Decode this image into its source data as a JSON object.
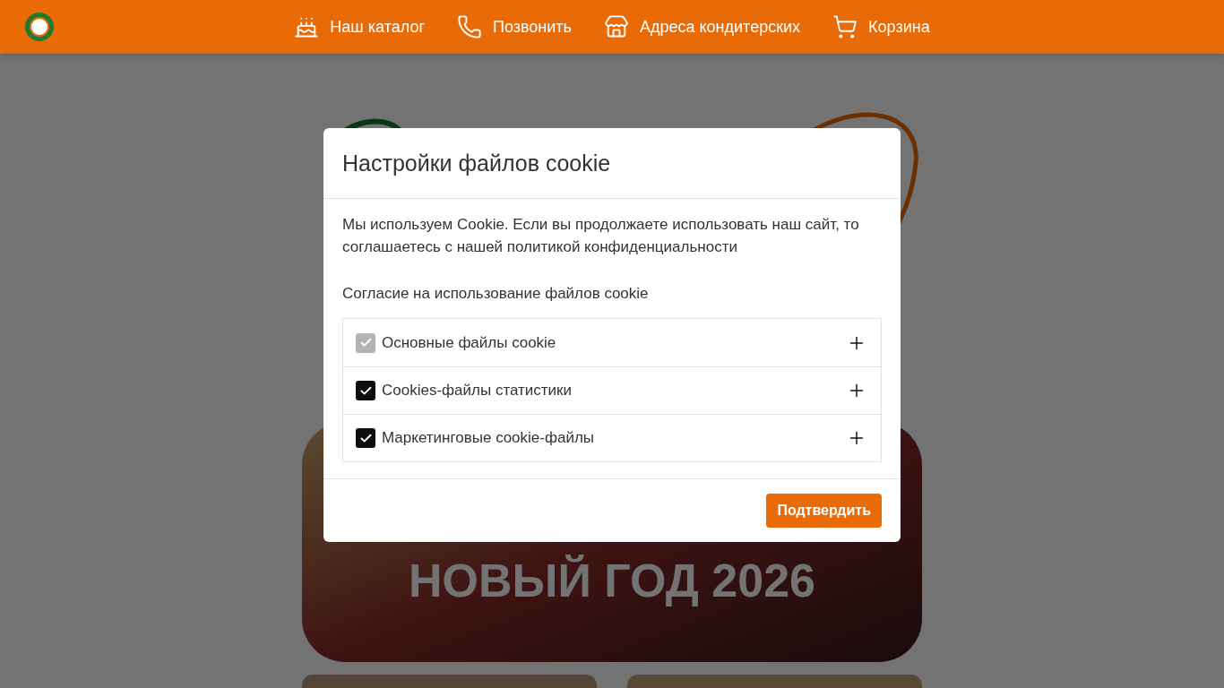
{
  "header": {
    "nav": [
      {
        "kind": "catalog",
        "label": "Наш каталог"
      },
      {
        "kind": "call",
        "label": "Позвонить"
      },
      {
        "kind": "shops",
        "label": "Адреса кондитерских"
      },
      {
        "kind": "cart",
        "label": "Корзина"
      }
    ]
  },
  "banner": {
    "title": "НОВЫЙ ГОД 2026"
  },
  "cookie_dialog": {
    "title": "Настройки файлов cookie",
    "description": "Мы используем Cookie. Если вы продолжаете использовать наш сайт, то соглашаетесь с нашей политикой конфиденциальности",
    "consent_heading": "Согласие на использование файлов cookie",
    "options": [
      {
        "label": "Основные файлы cookie",
        "checked": true,
        "disabled": true,
        "expanded": false
      },
      {
        "label": "Cookies-файлы статистики",
        "checked": true,
        "disabled": false,
        "expanded": false
      },
      {
        "label": "Маркетинговые cookie-файлы",
        "checked": true,
        "disabled": false,
        "expanded": false
      }
    ],
    "confirm_button": "Подтвердить"
  }
}
